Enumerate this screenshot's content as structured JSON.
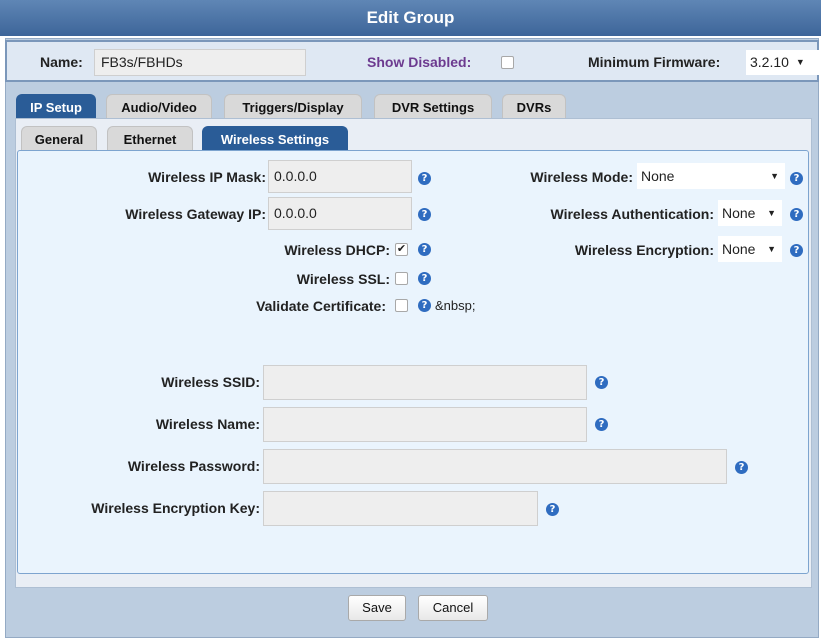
{
  "dialog": {
    "title": "Edit Group"
  },
  "header": {
    "name_label": "Name:",
    "name_value": "FB3s/FBHDs",
    "show_disabled_label": "Show Disabled:",
    "show_disabled_checked": false,
    "min_firmware_label": "Minimum Firmware:",
    "min_firmware_value": "3.2.10",
    "dropdown_arrow": "▼"
  },
  "tabs": [
    {
      "label": "IP Setup",
      "active": true
    },
    {
      "label": "Audio/Video",
      "active": false
    },
    {
      "label": "Triggers/Display",
      "active": false
    },
    {
      "label": "DVR Settings",
      "active": false
    },
    {
      "label": "DVRs",
      "active": false
    }
  ],
  "subtabs": [
    {
      "label": "General",
      "active": false
    },
    {
      "label": "Ethernet",
      "active": false
    },
    {
      "label": "Wireless Settings",
      "active": true
    }
  ],
  "help_glyph": "?",
  "check_glyph": "✔",
  "left_fields": {
    "ip_mask": {
      "label": "Wireless IP Mask:",
      "value": "0.0.0.0"
    },
    "gateway_ip": {
      "label": "Wireless Gateway IP:",
      "value": "0.0.0.0"
    },
    "dhcp": {
      "label": "Wireless DHCP:",
      "checked": true
    },
    "ssl": {
      "label": "Wireless SSL:",
      "checked": false
    },
    "validate_cert": {
      "label": "Validate Certificate:",
      "checked": false,
      "trailing_text": "&nbsp;"
    }
  },
  "right_fields": {
    "mode": {
      "label": "Wireless Mode:",
      "value": "None"
    },
    "authentication": {
      "label": "Wireless Authentication:",
      "value": "None"
    },
    "encryption": {
      "label": "Wireless Encryption:",
      "value": "None"
    }
  },
  "lower_fields": {
    "ssid": {
      "label": "Wireless SSID:",
      "value": ""
    },
    "name": {
      "label": "Wireless Name:",
      "value": ""
    },
    "password": {
      "label": "Wireless Password:",
      "value": ""
    },
    "encryption_key": {
      "label": "Wireless Encryption Key:",
      "value": ""
    }
  },
  "buttons": {
    "save": "Save",
    "cancel": "Cancel"
  }
}
